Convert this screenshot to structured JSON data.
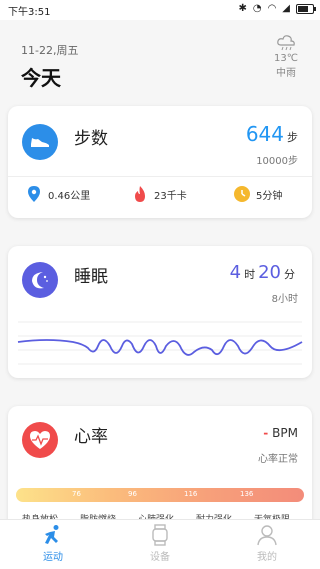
{
  "status_bar": {
    "time": "下午3:51"
  },
  "header": {
    "date": "11-22,周五",
    "title": "今天"
  },
  "weather": {
    "temp": "13℃",
    "condition": "中雨",
    "icon": "cloud-rain-icon"
  },
  "steps": {
    "title": "步数",
    "value": "644",
    "unit": "步",
    "goal": "10000步",
    "distance": "0.46公里",
    "calories": "23千卡",
    "duration": "5分钟"
  },
  "sleep": {
    "title": "睡眠",
    "hours": "4",
    "hours_unit": "时",
    "minutes": "20",
    "minutes_unit": "分",
    "goal": "8小时"
  },
  "heart": {
    "title": "心率",
    "value": "-",
    "unit": "BPM",
    "status": "心率正常",
    "zone_ticks": [
      "76",
      "96",
      "116",
      "136"
    ],
    "zones": [
      "热身放松",
      "脂肪燃烧",
      "心肺强化",
      "耐力强化",
      "无氧极限"
    ]
  },
  "nav": {
    "items": [
      {
        "label": "运动",
        "icon": "running-icon",
        "active": true
      },
      {
        "label": "设备",
        "icon": "watch-icon",
        "active": false
      },
      {
        "label": "我的",
        "icon": "person-icon",
        "active": false
      }
    ]
  },
  "colors": {
    "accent_blue": "#2c8ee8",
    "sleep_purple": "#5b5ee0",
    "heart_red": "#f04b4b"
  }
}
